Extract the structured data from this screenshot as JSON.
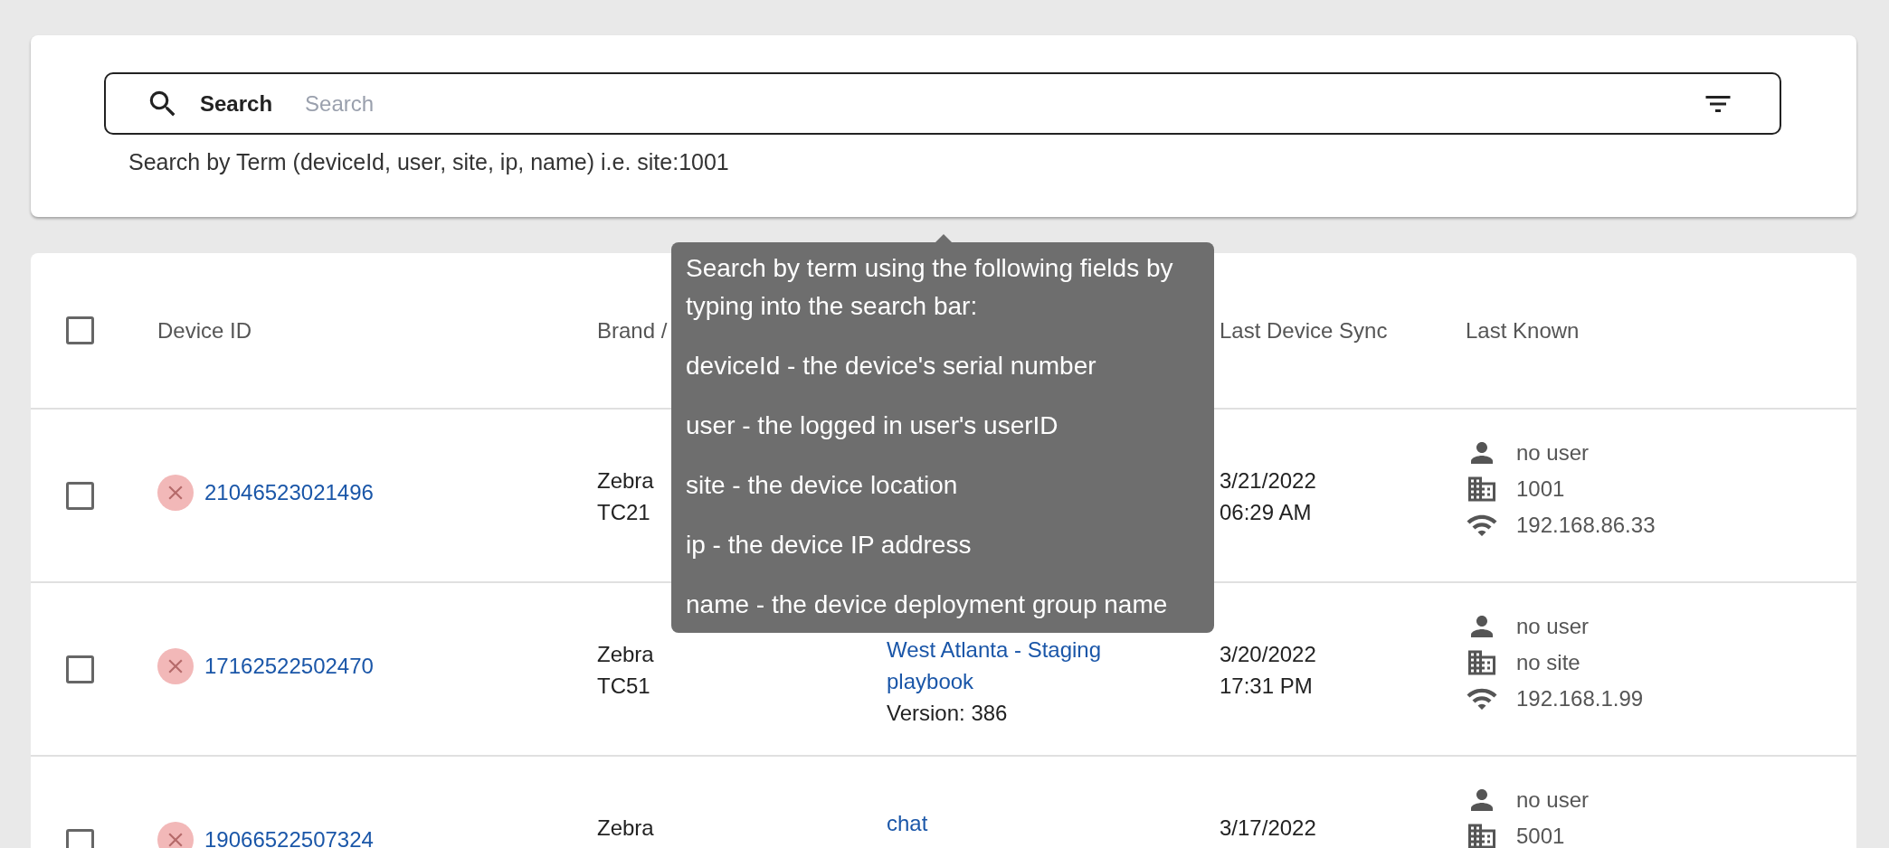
{
  "search": {
    "label": "Search",
    "placeholder": "Search",
    "helper_text": "Search by Term (deviceId, user, site, ip, name) i.e. site:1001"
  },
  "tooltip": {
    "lines": [
      "Search by term using the following fields by typing into the search bar:",
      "deviceId - the device's serial number",
      "user - the logged in user's userID",
      "site - the device location",
      "ip - the device IP address",
      "name - the device deployment group name"
    ]
  },
  "table": {
    "select_all_checked": false,
    "columns": {
      "device_id": "Device ID",
      "brand": "Brand /",
      "sync": "Last Device Sync",
      "known": "Last Known"
    },
    "rows": [
      {
        "checked": false,
        "device_id": "21046523021496",
        "brand": "Zebra",
        "model": "TC21",
        "sync_date": "3/21/2022",
        "sync_time": "06:29 AM",
        "user": "no user",
        "site": "1001",
        "ip": "192.168.86.33"
      },
      {
        "checked": false,
        "device_id": "17162522502470",
        "brand": "Zebra",
        "model": "TC51",
        "group": "West Atlanta - Staging playbook",
        "version": "Version: 386",
        "sync_date": "3/20/2022",
        "sync_time": "17:31 PM",
        "user": "no user",
        "site": "no site",
        "ip": "192.168.1.99"
      },
      {
        "checked": false,
        "device_id": "19066522507324",
        "brand": "Zebra",
        "group": "chat",
        "sync_date": "3/17/2022",
        "user": "no user",
        "site": "5001"
      }
    ]
  }
}
